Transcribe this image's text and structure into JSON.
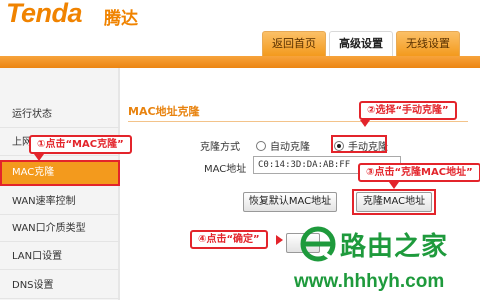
{
  "header": {
    "logo_en": "Tenda",
    "logo_cn": "腾达",
    "tabs": [
      {
        "label": "返回首页",
        "active": false
      },
      {
        "label": "高级设置",
        "active": true
      },
      {
        "label": "无线设置",
        "active": false
      }
    ]
  },
  "sidebar": {
    "items": [
      {
        "label": "运行状态",
        "active": false
      },
      {
        "label": "上网设置",
        "active": false
      },
      {
        "label": "MAC克隆",
        "active": true
      },
      {
        "label": "WAN速率控制",
        "active": false
      },
      {
        "label": "WAN口介质类型",
        "active": false
      },
      {
        "label": "LAN口设置",
        "active": false
      },
      {
        "label": "DNS设置",
        "active": false
      }
    ]
  },
  "main": {
    "title": "MAC地址克隆",
    "clone_method_label": "克隆方式",
    "radio_auto": "自动克隆",
    "radio_manual": "手动克隆",
    "selected_mode": "手动克隆",
    "mac_label": "MAC地址",
    "mac_value": "C0:14:3D:DA:AB:FF",
    "restore_button": "恢复默认MAC地址",
    "clone_button": "克隆MAC地址"
  },
  "callouts": {
    "step1": "①点击“MAC克隆”",
    "step2": "②选择“手动克隆”",
    "step3": "③点击“克隆MAC地址”",
    "step4": "④点击“确定”"
  },
  "watermark": {
    "text": "路由之家",
    "url": "www.hhhyh.com"
  },
  "colors": {
    "brand_orange": "#f08300",
    "accent_bar": "#ec8512",
    "callout_red": "#e3242b",
    "watermark_green": "#1e9a3c"
  }
}
